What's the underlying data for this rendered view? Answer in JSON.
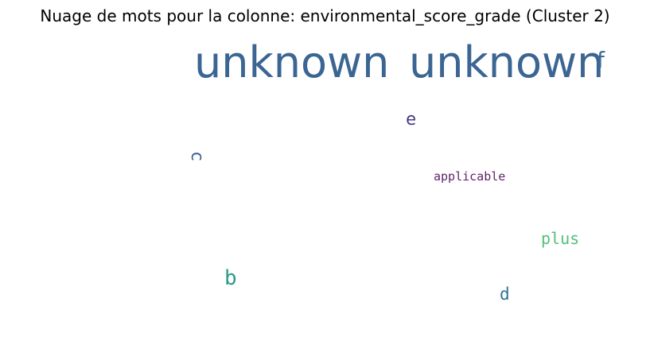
{
  "chart_data": {
    "type": "wordcloud",
    "title": "Nuage de mots pour la colonne: environmental_score_grade (Cluster 2)",
    "words": [
      {
        "text": "unknown",
        "color": "#3b6592",
        "weight": 1.0
      },
      {
        "text": "unknown",
        "color": "#3b6592",
        "weight": 1.0
      },
      {
        "text": "f",
        "color": "#3e6b96",
        "weight": 0.5
      },
      {
        "text": "e",
        "color": "#463c82",
        "weight": 0.4
      },
      {
        "text": "c",
        "color": "#3b5e95",
        "weight": 0.4,
        "orientation": "vertical"
      },
      {
        "text": "applicable",
        "color": "#5e2367",
        "weight": 0.3
      },
      {
        "text": "plus",
        "color": "#52bf78",
        "weight": 0.4
      },
      {
        "text": "b",
        "color": "#2a9a8a",
        "weight": 0.5
      },
      {
        "text": "d",
        "color": "#2d7497",
        "weight": 0.4
      }
    ]
  }
}
